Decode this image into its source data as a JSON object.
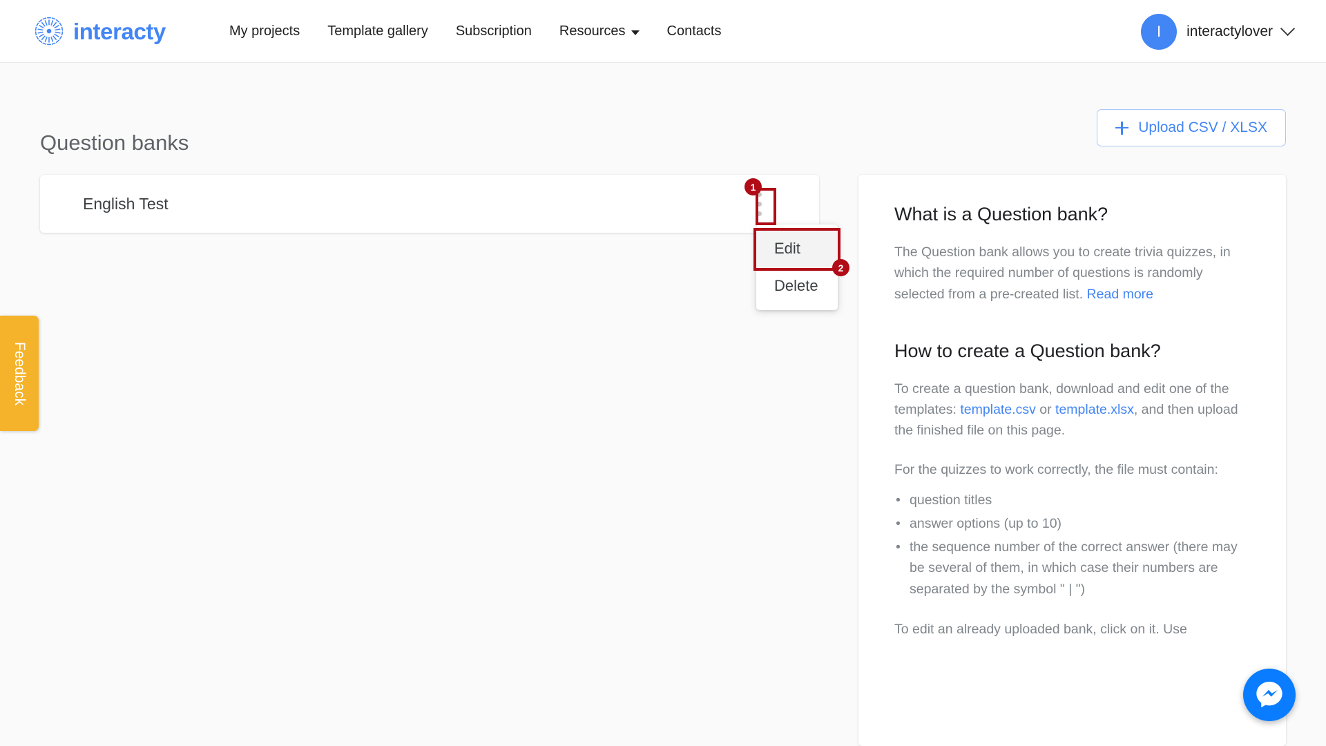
{
  "header": {
    "brand": {
      "name": "interacty",
      "icon": "interacty-logo-icon",
      "color": "#4285f4"
    },
    "nav": [
      {
        "label": "My projects",
        "has_caret": false
      },
      {
        "label": "Template gallery",
        "has_caret": false
      },
      {
        "label": "Subscription",
        "has_caret": false
      },
      {
        "label": "Resources",
        "has_caret": true
      },
      {
        "label": "Contacts",
        "has_caret": false
      }
    ],
    "user": {
      "avatar_initial": "I",
      "avatar_color": "#4285f4",
      "name": "interactylover",
      "chevron": "chevron-down-icon"
    }
  },
  "main": {
    "page_title": "Question banks",
    "upload_button": {
      "label": "Upload CSV / XLSX",
      "icon": "plus-icon",
      "color": "#4285f4"
    },
    "banks": [
      {
        "name": "English Test",
        "menu_icon": "kebab-menu-icon"
      }
    ],
    "context_menu": {
      "items": [
        {
          "label": "Edit",
          "hovered": true
        },
        {
          "label": "Delete",
          "hovered": false
        }
      ]
    }
  },
  "annotations": {
    "color": "#b00b16",
    "markers": [
      {
        "number": "1",
        "target": "kebab-menu-icon"
      },
      {
        "number": "2",
        "target": "context-menu-item-edit"
      }
    ]
  },
  "info_panel": {
    "section_1": {
      "heading": "What is a Question bank?",
      "body_before_link": "The Question bank allows you to create trivia quizzes, in which the required number of questions is randomly selected from a pre-created list. ",
      "link": "Read more"
    },
    "section_2": {
      "heading": "How to create a Question bank?",
      "body_part_1": "To create a question bank, download and edit one of the templates: ",
      "link_csv": "template.csv",
      "body_part_2": " or ",
      "link_xlsx": "template.xlsx",
      "body_part_3": ", and then upload the finished file on this page.",
      "requirements_intro": "For the quizzes to work correctly, the file must contain:",
      "requirements": [
        "question titles",
        "answer options (up to 10)",
        "the sequence number of the correct answer (there may be several of them, in which case their numbers are separated by the symbol \" | \")"
      ],
      "cut_off_line": "To edit an already uploaded bank, click on it. Use"
    }
  },
  "feedback_tab": {
    "label": "Feedback",
    "color": "#f5b32b"
  },
  "messenger_fab": {
    "icon": "messenger-icon",
    "color": "#0a7cff"
  }
}
